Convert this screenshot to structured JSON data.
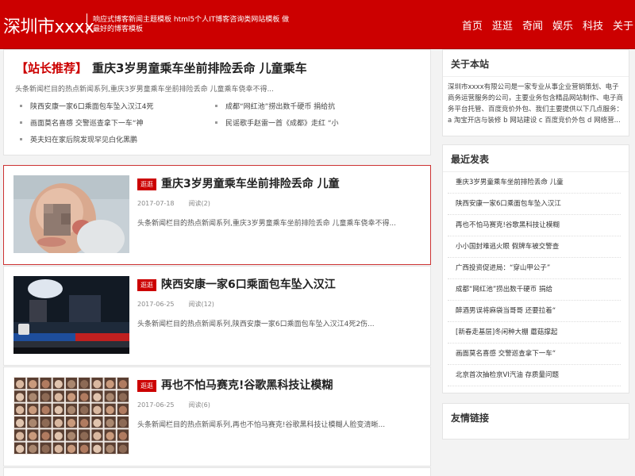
{
  "header": {
    "logo": "深圳市xxxx",
    "tagline": "响应式博客新闻主题模板 html5个人IT博客咨询类网站模板 做最好的博客模板",
    "nav": [
      "首页",
      "逛逛",
      "奇闻",
      "娱乐",
      "科技",
      "关于"
    ]
  },
  "featured": {
    "tag": "【站长推荐】",
    "title": "重庆3岁男童乘车坐前排险丢命 儿童乘车",
    "desc": "头条新闻栏目的热点新闻系列,重庆3岁男童乘车坐前排险丢命 儿童乘车侥幸不得...",
    "links": [
      "陕西安康一家6口乘面包车坠入汉江4死",
      "成都“网红池”捞出数千硬币 捐给抗",
      "画面莫名喜感 交警巡查拿下一车“神",
      "民谣歌手赵雷一首《成都》走红 “小",
      "英夫妇在家后院发现罕见白化黑鹏"
    ]
  },
  "articles": [
    {
      "badge": "逛逛",
      "title": "重庆3岁男童乘车坐前排险丢命 儿童",
      "date": "2017-07-18",
      "reads": "阅读(2)",
      "desc": "头条新闻栏目的热点新闻系列,重庆3岁男童乘车坐前排险丢命 儿童乘车侥幸不得..."
    },
    {
      "badge": "逛逛",
      "title": "陕西安康一家6口乘面包车坠入汉江",
      "date": "2017-06-25",
      "reads": "阅读(12)",
      "desc": "头条新闻栏目的热点新闻系列,陕西安康一家6口乘面包车坠入汉江4死2伤..."
    },
    {
      "badge": "逛逛",
      "title": "再也不怕马赛克!谷歌黑科技让模糊",
      "date": "2017-06-25",
      "reads": "阅读(6)",
      "desc": "头条新闻栏目的热点新闻系列,再也不怕马赛克!谷歌黑科技让模糊人脸变清晰..."
    }
  ],
  "sidebar": {
    "about_title": "关于本站",
    "about_text": "深圳市xxxx有限公司是一家专业从事企业营销策划、电子商务运营服务的公司，主要业务包含精品网站制作、电子商务平台托管、百度竞价外包、我们主要提供以下几点服务：a 淘宝开店与装修 b 网站建设 c 百度竞价外包 d 网络营...",
    "recent_title": "最近发表",
    "recent": [
      "重庆3岁男童乘车坐前排险丢命 儿童",
      "陕西安康一家6口乘面包车坠入汉江",
      "再也不怕马赛克!谷歌黑科技让模糊",
      "小小国封难逃火眼 假牌车被交警查",
      "广西投资促进局：“穿山甲公子”",
      "成都“网红池”捞出数千硬币 捐给",
      "醉酒男误将麻袋当哥哥 还要拉着“",
      "[新春走基层]冬闲种大棚 蘑菇撑起",
      "画面莫名喜感 交警巡查拿下一车“",
      "北京首次抽检京VI汽油 存质量问题"
    ],
    "links_title": "友情链接"
  }
}
